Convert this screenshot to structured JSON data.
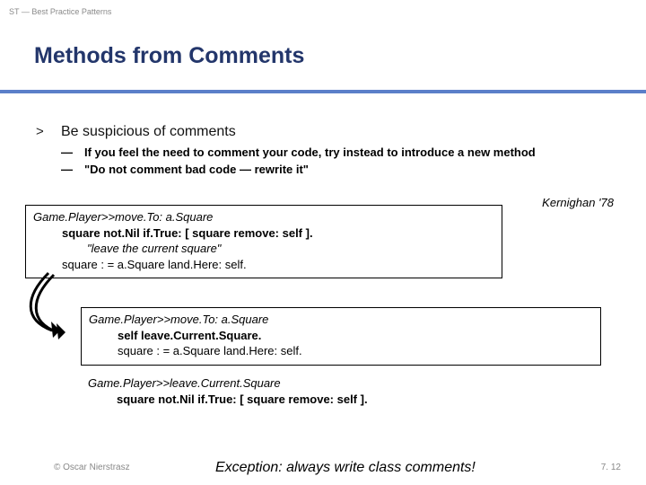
{
  "header": "ST — Best Practice Patterns",
  "title": "Methods from Comments",
  "bullet": {
    "marker": ">",
    "text": "Be suspicious of comments",
    "subs": [
      "If you feel the need to comment your code, try instead to introduce a new method",
      "\"Do not comment bad code — rewrite it\""
    ]
  },
  "attribution": "Kernighan '78",
  "code1": {
    "sig": "Game.Player>>move.To: a.Square",
    "l1": "square not.Nil if.True: [ square remove: self ].",
    "l2": "\"leave the current square\"",
    "l3": "square : = a.Square land.Here: self."
  },
  "code2": {
    "sig": "Game.Player>>move.To: a.Square",
    "l1": "self leave.Current.Square.",
    "l2": "square : = a.Square land.Here: self."
  },
  "code3": {
    "sig": "Game.Player>>leave.Current.Square",
    "l1": "square not.Nil if.True: [ square remove: self ]."
  },
  "exception": "Exception: always write class comments!",
  "copyright": "© Oscar Nierstrasz",
  "page": "7. 12"
}
